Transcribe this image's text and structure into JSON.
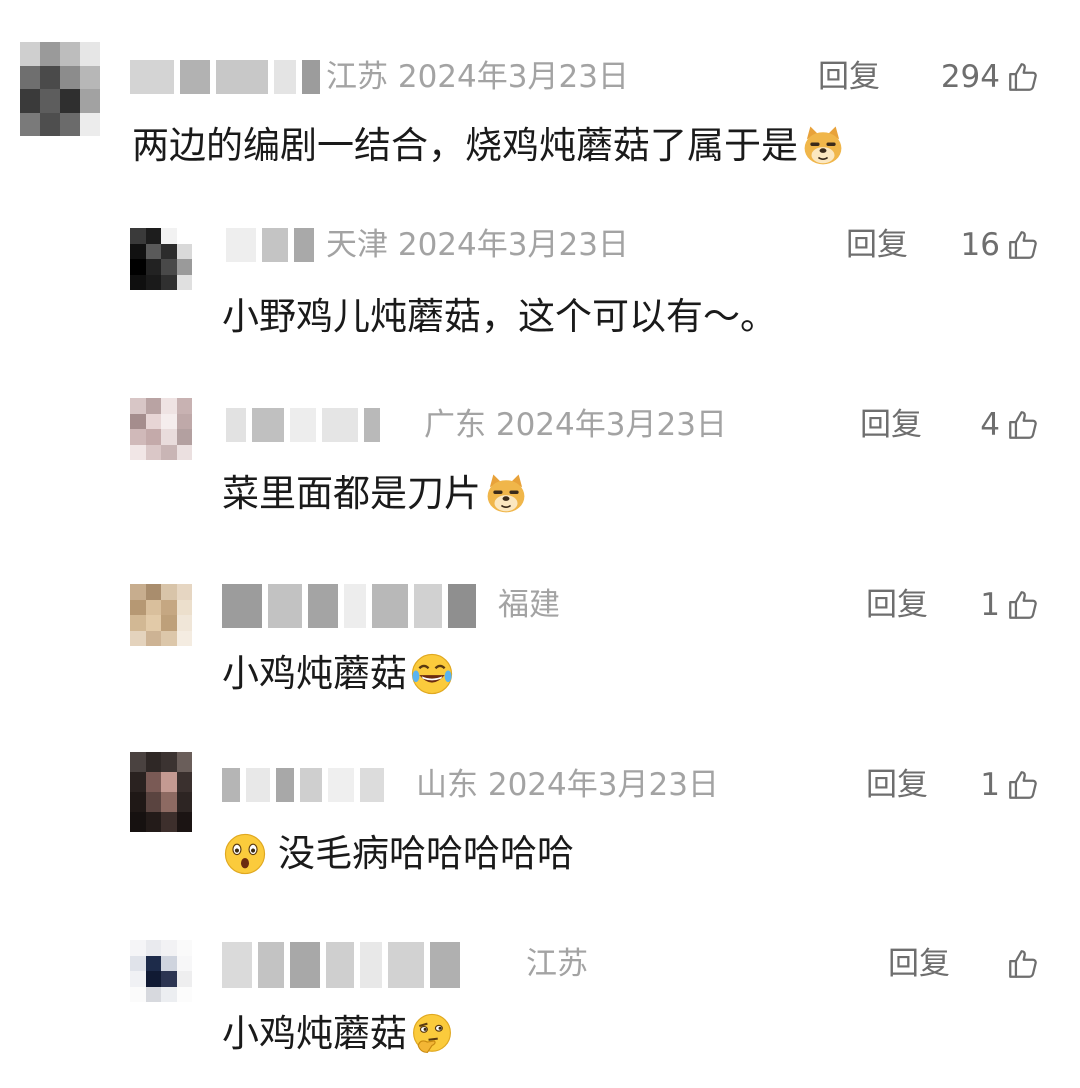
{
  "comments": [
    {
      "region": "江苏",
      "date": "2024年3月23日",
      "reply_label": "回复",
      "likes": "294",
      "text": "两边的编剧一结合，烧鸡炖蘑菇了属于是",
      "emoji": "doge-emoji"
    },
    {
      "region": "天津",
      "date": "2024年3月23日",
      "reply_label": "回复",
      "likes": "16",
      "text": "小野鸡儿炖蘑菇，这个可以有～。"
    },
    {
      "region": "广东",
      "date": "2024年3月23日",
      "reply_label": "回复",
      "likes": "4",
      "text": "菜里面都是刀片",
      "emoji": "doge-emoji"
    },
    {
      "region": "福建",
      "date": "",
      "reply_label": "回复",
      "likes": "1",
      "text": "小鸡炖蘑菇",
      "emoji": "laugh-cry-emoji"
    },
    {
      "region": "山东",
      "date": "2024年3月23日",
      "reply_label": "回复",
      "likes": "1",
      "text": "没毛病哈哈哈哈哈",
      "emoji": "astonished-emoji"
    },
    {
      "region": "江苏",
      "date": "",
      "reply_label": "回复",
      "likes": "",
      "text": "小鸡炖蘑菇",
      "emoji": "thinking-emoji"
    }
  ],
  "colors": {
    "meta_text": "#a3a3a3",
    "reply_text": "#6e6e6e",
    "body_text": "#1a1a1a"
  }
}
